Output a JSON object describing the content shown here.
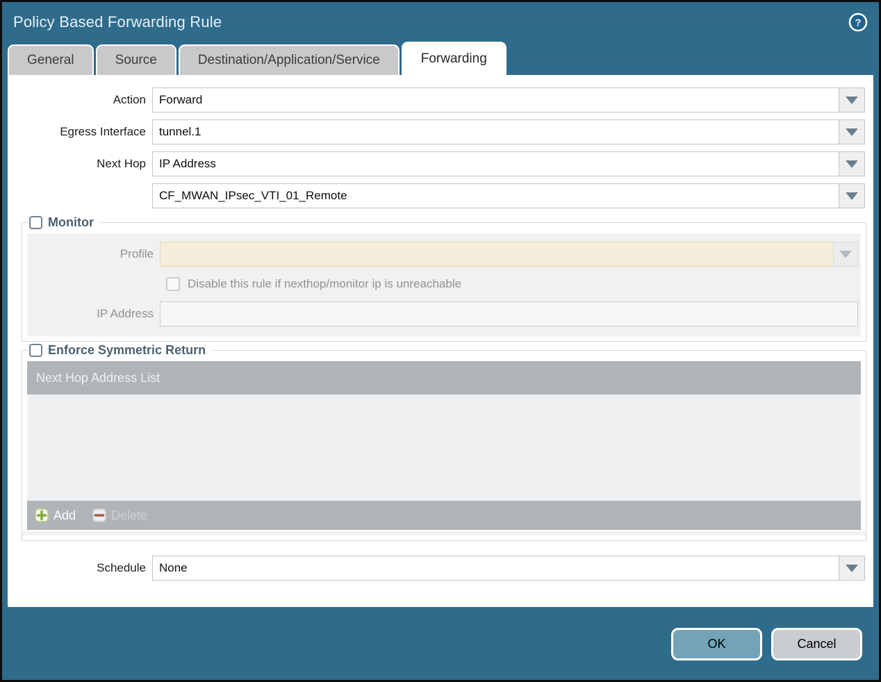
{
  "window": {
    "title": "Policy Based Forwarding Rule"
  },
  "tabs": [
    {
      "label": "General",
      "active": false
    },
    {
      "label": "Source",
      "active": false
    },
    {
      "label": "Destination/Application/Service",
      "active": false
    },
    {
      "label": "Forwarding",
      "active": true
    }
  ],
  "fields": {
    "action": {
      "label": "Action",
      "value": "Forward"
    },
    "egress_interface": {
      "label": "Egress Interface",
      "value": "tunnel.1"
    },
    "next_hop": {
      "label": "Next Hop",
      "value": "IP Address"
    },
    "next_hop_address": {
      "value": "CF_MWAN_IPsec_VTI_01_Remote"
    },
    "schedule": {
      "label": "Schedule",
      "value": "None"
    }
  },
  "monitor": {
    "title": "Monitor",
    "checked": false,
    "profile": {
      "label": "Profile",
      "value": ""
    },
    "disable_rule": {
      "label": "Disable this rule if nexthop/monitor ip is unreachable",
      "checked": false
    },
    "ip_address": {
      "label": "IP Address",
      "value": ""
    }
  },
  "enforce_symmetric_return": {
    "title": "Enforce Symmetric Return",
    "checked": false,
    "list_header": "Next Hop Address List",
    "rows": [],
    "add_label": "Add",
    "delete_label": "Delete",
    "delete_enabled": false
  },
  "buttons": {
    "ok": "OK",
    "cancel": "Cancel"
  },
  "icons": {
    "help": "help-icon",
    "dropdown": "chevron-down-icon",
    "add": "plus-icon",
    "delete": "minus-icon"
  },
  "colors": {
    "titlebar_teal": "#2f6b8b",
    "ok_button": "#72a3b6",
    "cancel_button": "#c9ccd0",
    "table_header_gray": "#b0b4b7",
    "disabled_field_cream": "#f5eedb",
    "accent_slate": "#4c6170"
  }
}
